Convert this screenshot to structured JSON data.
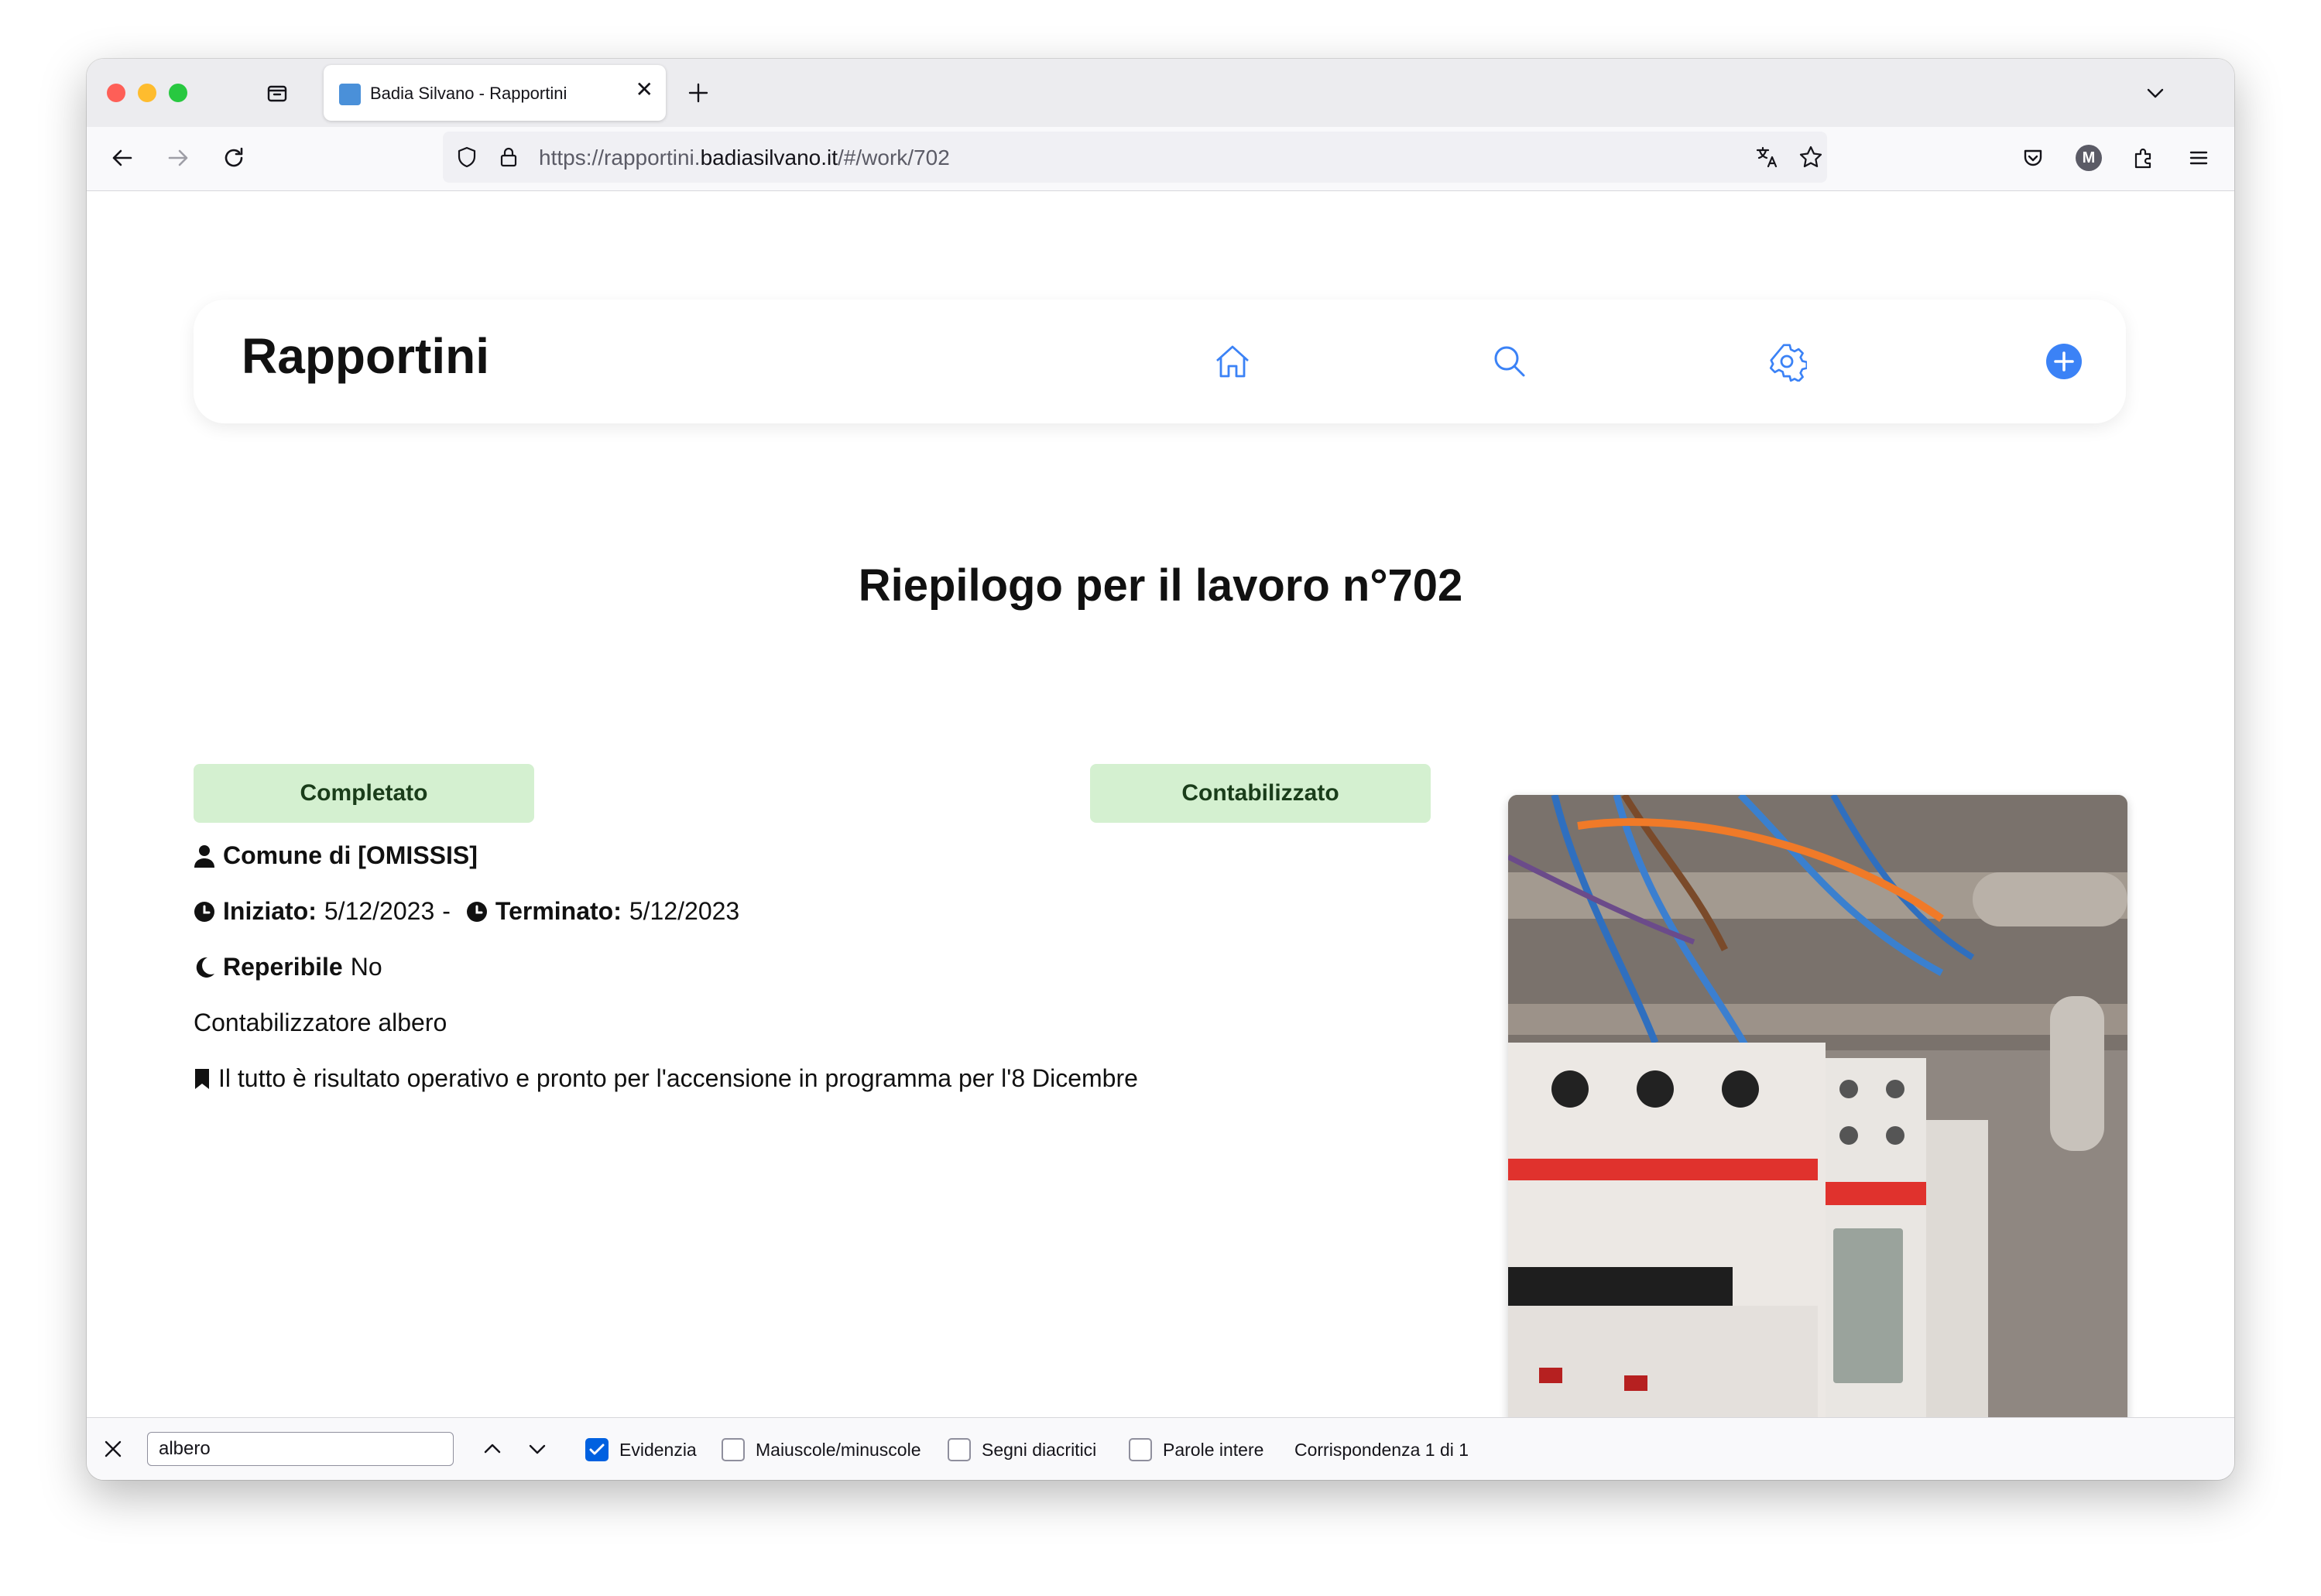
{
  "browser": {
    "tab": {
      "title": "Badia Silvano - Rapportini",
      "favicon": "town-crest-icon"
    },
    "url": {
      "prefix": "https://rapportini.",
      "domain": "badiasilvano.it",
      "suffix": "/#/work/702"
    },
    "profile_initial": "M"
  },
  "app": {
    "brand": "Rapportini",
    "nav": [
      {
        "icon": "home-icon"
      },
      {
        "icon": "search-icon"
      },
      {
        "icon": "gear-icon"
      },
      {
        "icon": "plus-circle-icon"
      }
    ],
    "accent": "#3b82f6"
  },
  "page": {
    "title": "Riepilogo per il lavoro n°702",
    "status_badges": [
      "Completato",
      "Contabilizzato"
    ],
    "badge_color": "#d4f0d0",
    "client_label": "Comune di [OMISSIS]",
    "started_label": "Iniziato:",
    "started_value": "5/12/2023",
    "separator": "-",
    "finished_label": "Terminato:",
    "finished_value": "5/12/2023",
    "on_call_label": "Reperibile",
    "on_call_value": "No",
    "description": "Contabilizzatore albero",
    "note": "Il tutto è risultato operativo e pronto per l'accensione in programma per l'8 Dicembre",
    "photo": "electrical-panel-photo"
  },
  "findbar": {
    "query": "albero",
    "options": [
      {
        "label": "Evidenzia",
        "checked": true
      },
      {
        "label": "Maiuscole/minuscole",
        "checked": false
      },
      {
        "label": "Segni diacritici",
        "checked": false
      },
      {
        "label": "Parole intere",
        "checked": false
      }
    ],
    "match_status": "Corrispondenza 1 di 1"
  }
}
